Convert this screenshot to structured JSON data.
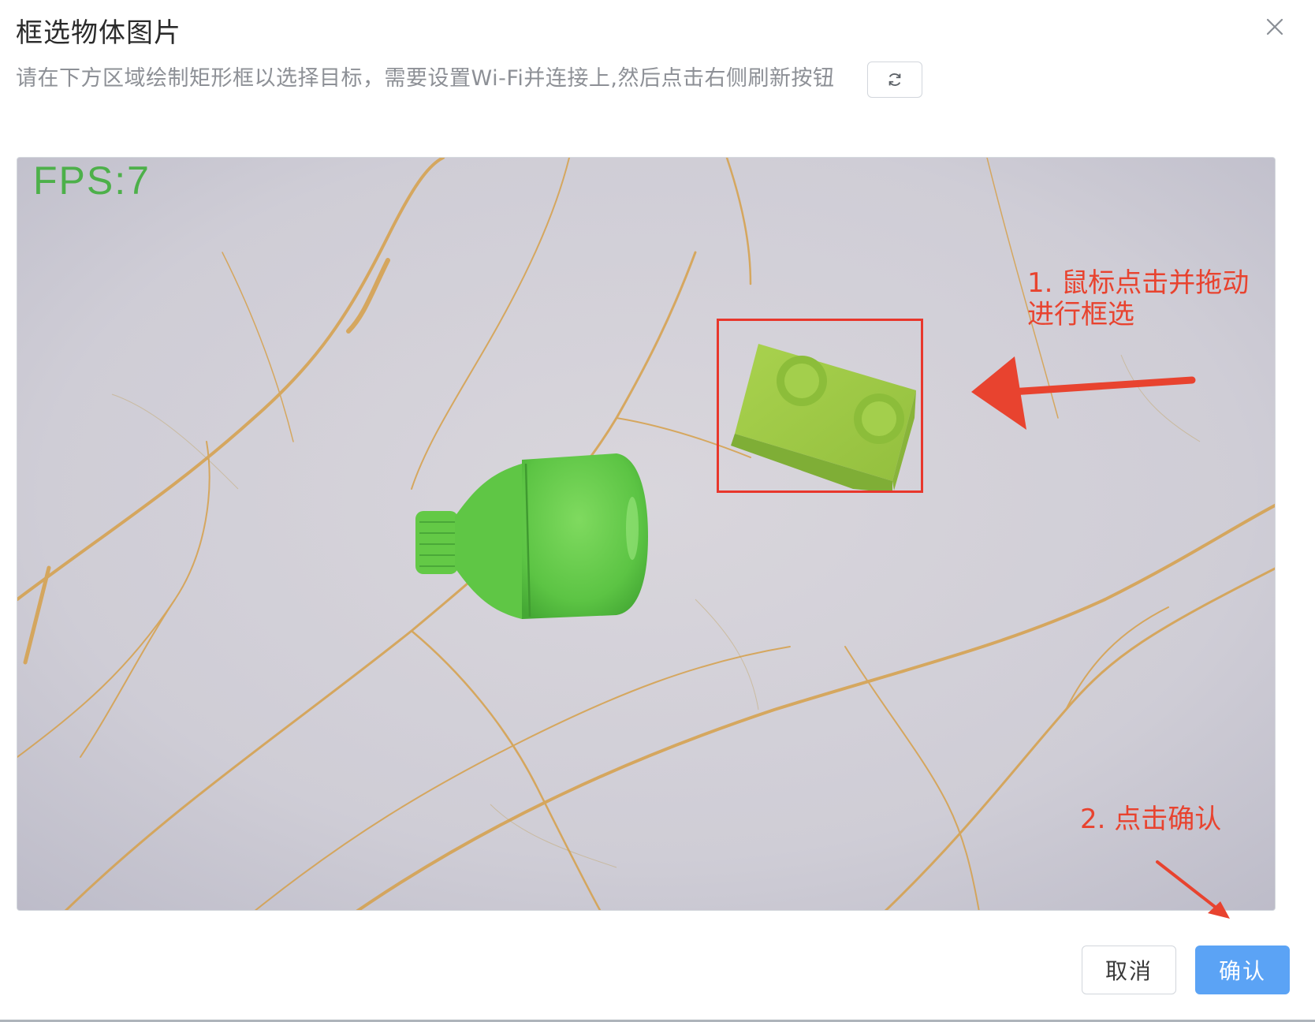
{
  "dialog": {
    "title": "框选物体图片",
    "subtitle": "请在下方区域绘制矩形框以选择目标，需要设置Wi-Fi并连接上,然后点击右侧刷新按钮",
    "close_icon": "close-icon",
    "refresh_icon": "refresh-icon"
  },
  "camera": {
    "fps_label": "FPS:7",
    "annotation_step1_line1": "1. 鼠标点击并拖动",
    "annotation_step1_line2": "进行框选",
    "annotation_step2": "2. 点击确认",
    "annotation_color": "#e8432f",
    "selection_color": "#e8372c"
  },
  "footer": {
    "cancel_label": "取消",
    "confirm_label": "确认",
    "confirm_color": "#5ba3f5"
  }
}
